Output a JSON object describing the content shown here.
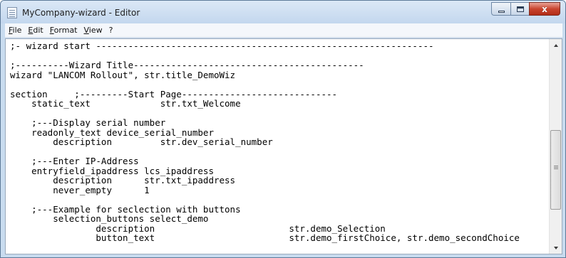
{
  "window": {
    "title": "MyCompany-wizard - Editor",
    "caption_close": "x"
  },
  "menu": [
    {
      "label": "File",
      "accel": "F"
    },
    {
      "label": "Edit",
      "accel": "E"
    },
    {
      "label": "Format",
      "accel": "F"
    },
    {
      "label": "View",
      "accel": "V"
    },
    {
      "label": "?",
      "accel": ""
    }
  ],
  "editor": {
    "lines": [
      ";- wizard start ---------------------------------------------------------------",
      "",
      ";----------Wizard Title-------------------------------------------",
      "wizard \"LANCOM Rollout\", str.title_DemoWiz",
      "",
      "section     ;---------Start Page-----------------------------",
      "    static_text             str.txt_Welcome",
      "",
      "    ;---Display serial number",
      "    readonly_text device_serial_number",
      "        description         str.dev_serial_number",
      "",
      "    ;---Enter IP-Address",
      "    entryfield_ipaddress lcs_ipaddress",
      "        description      str.txt_ipaddress",
      "        never_empty      1",
      "",
      "    ;---Example for seclection with buttons",
      "        selection_buttons select_demo",
      "                description                         str.demo_Selection",
      "                button_text                         str.demo_firstChoice, str.demo_secondChoice"
    ]
  },
  "icons": {
    "app": "notepad-icon",
    "minimize": "minimize-icon",
    "maximize": "maximize-icon",
    "close": "close-icon",
    "scroll_up": "chevron-up-icon",
    "scroll_down": "chevron-down-icon"
  },
  "colors": {
    "close_button": "#c9452f",
    "titlebar": "#c3d7ee"
  }
}
